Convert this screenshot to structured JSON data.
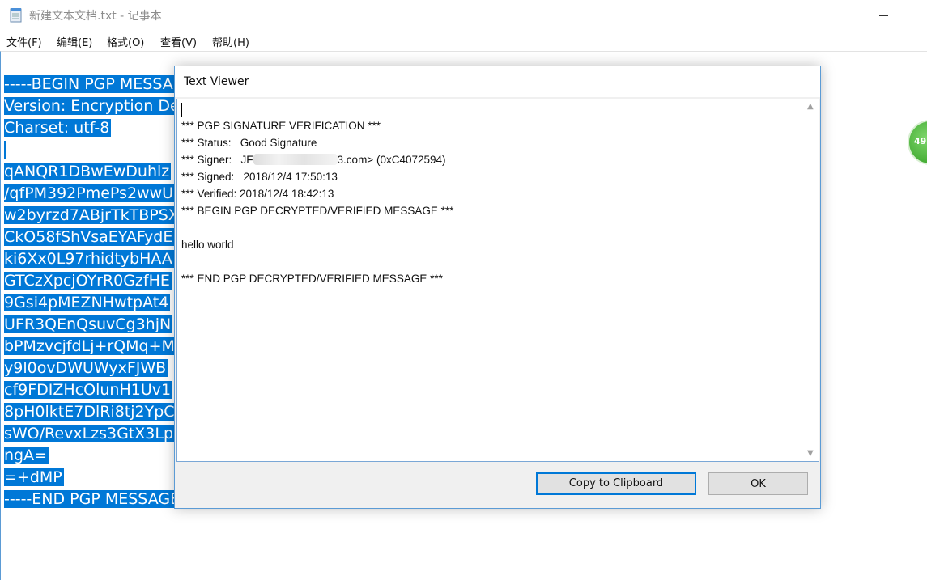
{
  "notepad": {
    "title": "新建文本文档.txt - 记事本",
    "menu": [
      "文件(F)",
      "编辑(E)",
      "格式(O)",
      "查看(V)",
      "帮助(H)"
    ],
    "lines": [
      "-----BEGIN PGP MESSA",
      "Version: Encryption De",
      "Charset: utf-8",
      "",
      "qANQR1DBwEwDuhlz",
      "/qfPM392PmePs2wwU",
      "w2byrzd7ABjrTkTBPSX",
      "CkO58fShVsaEYAFydE",
      "ki6Xx0L97rhidtybHAA",
      "GTCzXpcjOYrR0GzfHE",
      "9Gsi4pMEZNHwtpAt4",
      "UFR3QEnQsuvCg3hjN",
      "bPMzvcjfdLj+rQMq+M",
      "y9l0ovDWUWyxFJWB",
      "cf9FDIZHcOlunH1Uv1",
      "8pH0lktE7DlRi8tj2YpC",
      "sWO/RevxLzs3GtX3Lp",
      "ngA=",
      "=+dMP",
      "-----END PGP MESSAGE-----"
    ],
    "badge": "49"
  },
  "dialog": {
    "title": "Text Viewer",
    "lines": {
      "header": "*** PGP SIGNATURE VERIFICATION ***",
      "status": "*** Status:   Good Signature",
      "signer_prefix": "*** Signer:   JF",
      "signer_suffix": "3.com> (0xC4072594)",
      "signed": "*** Signed:   2018/12/4 17:50:13",
      "verified": "*** Verified: 2018/12/4 18:42:13",
      "begin": "*** BEGIN PGP DECRYPTED/VERIFIED MESSAGE ***",
      "message": "hello world",
      "end": "*** END PGP DECRYPTED/VERIFIED MESSAGE ***"
    },
    "buttons": {
      "copy": "Copy to Clipboard",
      "ok": "OK"
    }
  },
  "colors": {
    "selection": "#0078d7",
    "dialog_border": "#5b9bd5",
    "primary_button_border": "#0078d7"
  },
  "icons": [
    "notepad-app-icon",
    "minimize-icon",
    "scroll-up-icon",
    "scroll-down-icon"
  ]
}
